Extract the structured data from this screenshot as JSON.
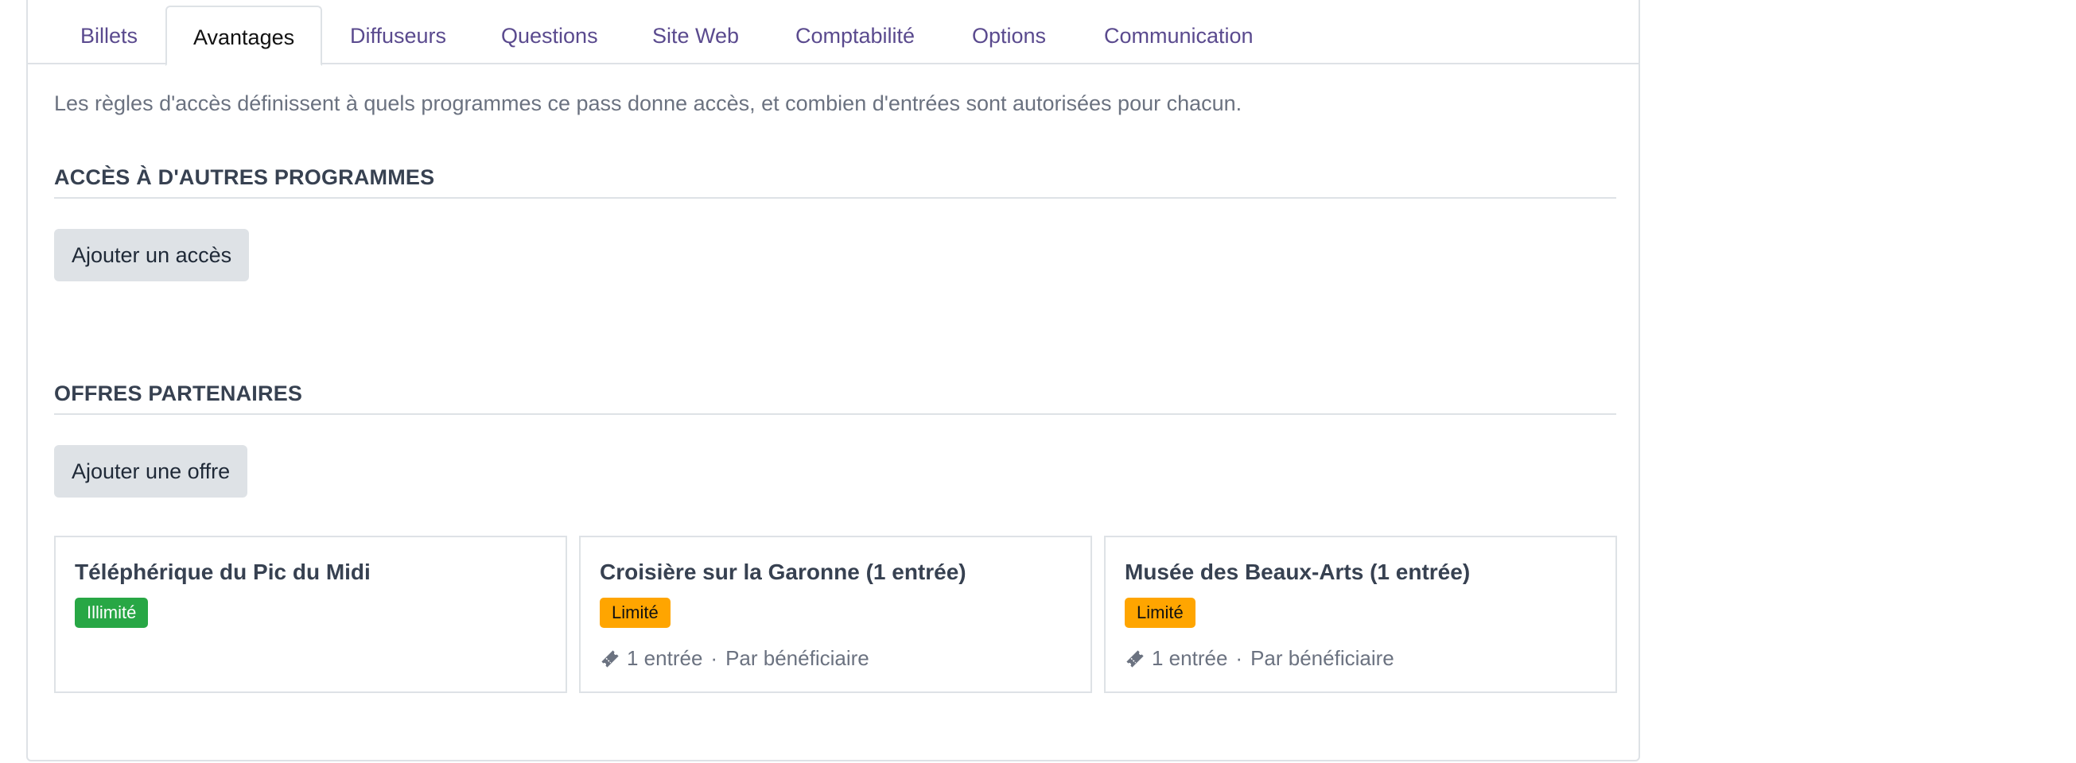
{
  "tabs": [
    {
      "label": "Billets",
      "active": false
    },
    {
      "label": "Avantages",
      "active": true
    },
    {
      "label": "Diffuseurs",
      "active": false
    },
    {
      "label": "Questions",
      "active": false
    },
    {
      "label": "Site Web",
      "active": false
    },
    {
      "label": "Comptabilité",
      "active": false
    },
    {
      "label": "Options",
      "active": false
    },
    {
      "label": "Communication",
      "active": false
    }
  ],
  "intro": "Les règles d'accès définissent à quels programmes ce pass donne accès, et combien d'entrées sont autorisées pour chacun.",
  "access": {
    "title": "ACCÈS À D'AUTRES PROGRAMMES",
    "add_button": "Ajouter un accès"
  },
  "partners": {
    "title": "OFFRES PARTENAIRES",
    "add_button": "Ajouter une offre",
    "offers": [
      {
        "title": "Téléphérique du Pic du Midi",
        "badge": "Illimité",
        "badge_color": "#28a745"
      },
      {
        "title": "Croisière sur la Garonne (1 entrée)",
        "badge": "Limité",
        "badge_color": "#ffa500",
        "entries": "1 entrée",
        "separator": "·",
        "scope": "Par bénéficiaire",
        "icon": "ticket-icon"
      },
      {
        "title": "Musée des Beaux-Arts (1 entrée)",
        "badge": "Limité",
        "badge_color": "#ffa500",
        "entries": "1 entrée",
        "separator": "·",
        "scope": "Par bénéficiaire",
        "icon": "ticket-icon"
      }
    ]
  },
  "colors": {
    "tab_link": "#5a4a8e",
    "unlimited": "#28a745",
    "limited": "#ffa500",
    "button_bg": "#dee2e6"
  }
}
